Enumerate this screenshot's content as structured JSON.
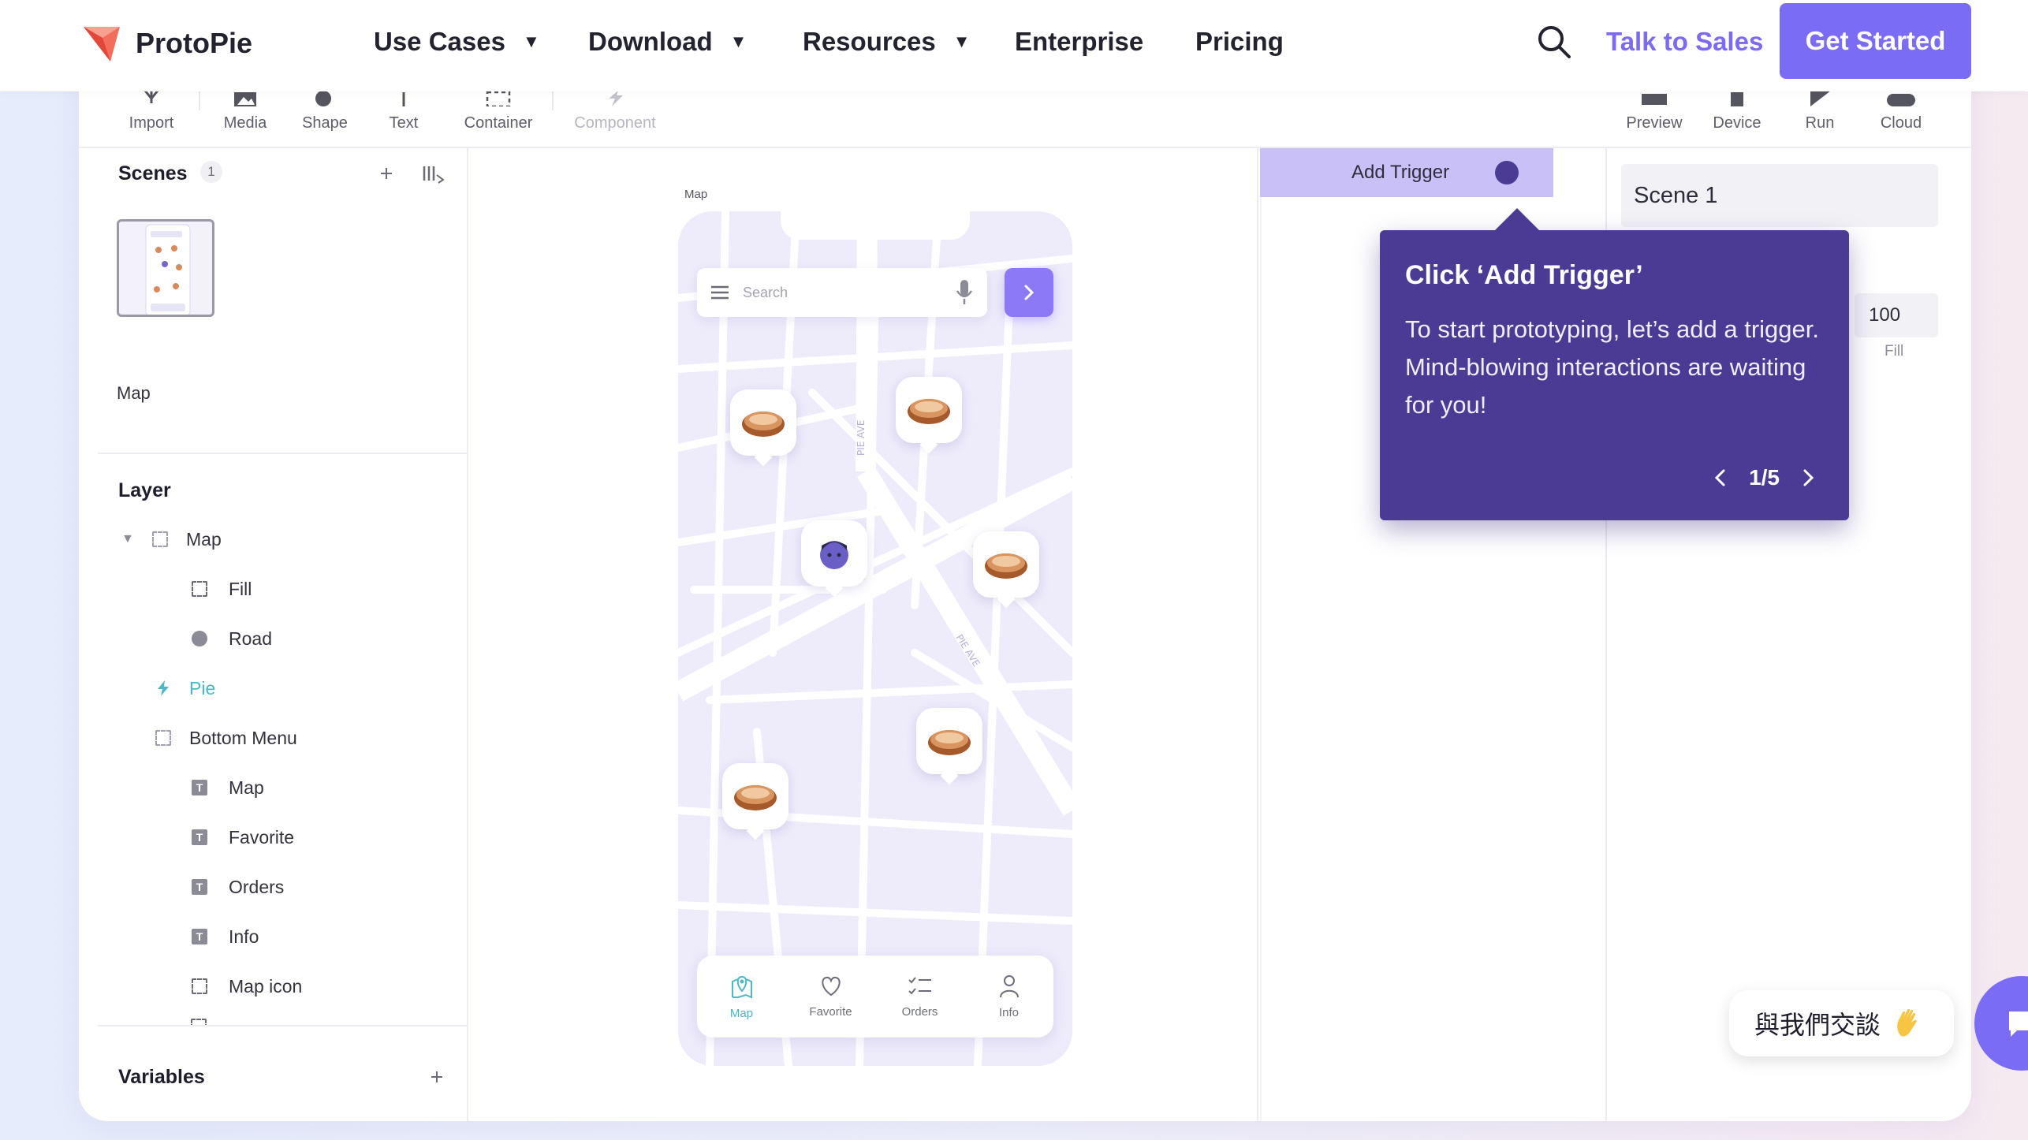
{
  "brand": {
    "name": "ProtoPie"
  },
  "nav": {
    "items": [
      {
        "label": "Use Cases",
        "has_dropdown": true
      },
      {
        "label": "Download",
        "has_dropdown": true
      },
      {
        "label": "Resources",
        "has_dropdown": true
      },
      {
        "label": "Enterprise",
        "has_dropdown": false
      },
      {
        "label": "Pricing",
        "has_dropdown": false
      }
    ],
    "talk_to_sales": "Talk to Sales",
    "get_started": "Get Started"
  },
  "toolbar": {
    "left_tools": [
      "Import",
      "Media",
      "Shape",
      "Text",
      "Container",
      "Component"
    ],
    "right_tools": [
      "Preview",
      "Device",
      "Run",
      "Cloud"
    ]
  },
  "scenes": {
    "title": "Scenes",
    "count": "1",
    "items": [
      {
        "label": "Map"
      }
    ]
  },
  "layers": {
    "title": "Layer",
    "items": [
      {
        "label": "Map",
        "icon": "frame-icon"
      },
      {
        "label": "Fill",
        "icon": "frame-icon"
      },
      {
        "label": "Road",
        "icon": "circle-icon"
      },
      {
        "label": "Pie",
        "icon": "bolt-icon"
      },
      {
        "label": "Bottom Menu",
        "icon": "frame-icon"
      },
      {
        "label": "Map",
        "icon": "text-icon"
      },
      {
        "label": "Favorite",
        "icon": "text-icon"
      },
      {
        "label": "Orders",
        "icon": "text-icon"
      },
      {
        "label": "Info",
        "icon": "text-icon"
      },
      {
        "label": "Map icon",
        "icon": "frame-icon"
      }
    ]
  },
  "variables": {
    "title": "Variables"
  },
  "canvas": {
    "frame_label": "Map",
    "search_placeholder": "Search",
    "street_labels": [
      "PIE AVE",
      "PIE AVE"
    ],
    "bottom_menu": [
      "Map",
      "Favorite",
      "Orders",
      "Info"
    ]
  },
  "interaction": {
    "add_trigger": "Add Trigger"
  },
  "properties": {
    "scene_name": "Scene 1",
    "fill_value": "100",
    "fill_label": "Fill"
  },
  "tooltip": {
    "title": "Click ‘Add Trigger’",
    "body": "To start prototyping, let’s add a trigger. Mind-blowing interactions are waiting for you!",
    "page": "1/5"
  },
  "chat": {
    "label": "與我們交談"
  },
  "colors": {
    "accent": "#7b6cf6",
    "tooltip_bg": "#4b3b95",
    "trigger_bg": "#c9c0f8",
    "active_tab": "#4bb7c9"
  }
}
